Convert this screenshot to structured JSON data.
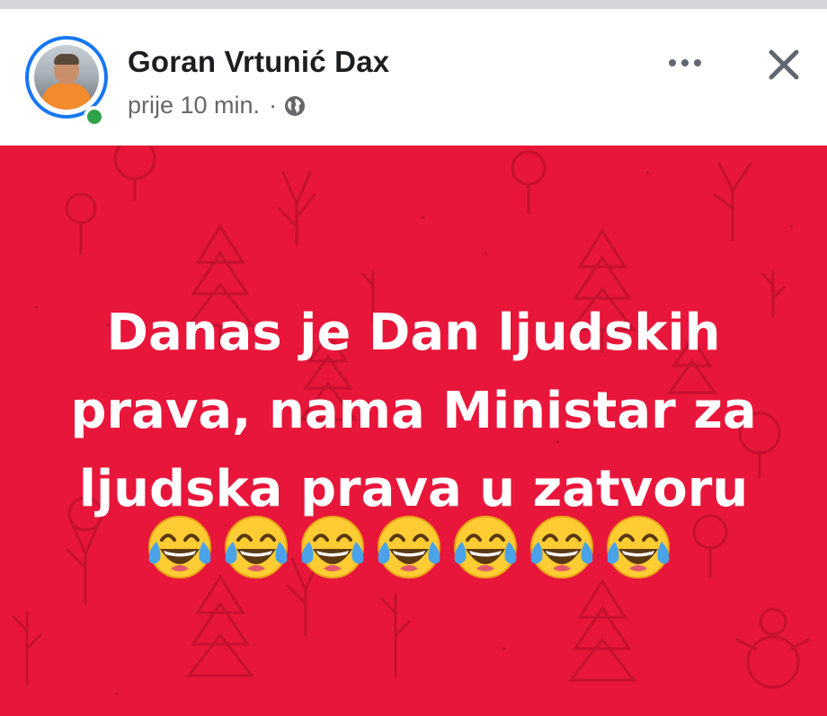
{
  "post": {
    "author_name": "Goran Vrtunić Dax",
    "timestamp": "prije 10 min.",
    "separator": "·",
    "privacy_icon": "globe-icon",
    "online": true,
    "more_icon": "more-options-icon",
    "close_icon": "close-icon",
    "text_lines": [
      "Danas je Dan ljudskih",
      "prava, nama Ministar za",
      "ljudska prava u zatvoru"
    ],
    "emoji": [
      "😂",
      "😂",
      "😂",
      "😂",
      "😂",
      "😂",
      "😂"
    ],
    "emoji_name": "face-with-tears-of-joy"
  },
  "colors": {
    "background": "#e8163a",
    "text": "#ffffff",
    "avatar_ring": "#1877f2",
    "online_dot": "#31a24c"
  }
}
